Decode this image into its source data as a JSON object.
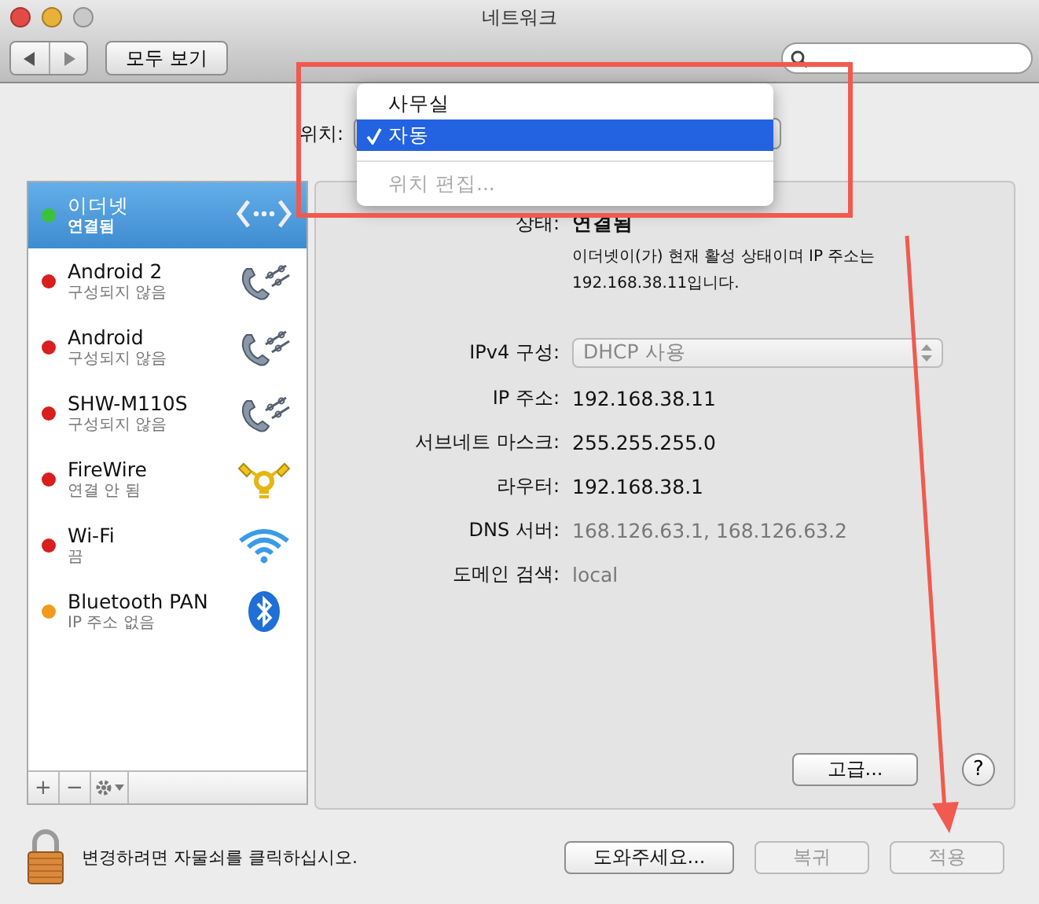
{
  "window": {
    "title": "네트워크"
  },
  "toolbar": {
    "show_all": "모두 보기"
  },
  "location": {
    "label": "위치:",
    "menu": [
      {
        "kind": "option",
        "label": "사무실",
        "selected": false,
        "disabled": false
      },
      {
        "kind": "option",
        "label": "자동",
        "selected": true,
        "disabled": false
      },
      {
        "kind": "separator"
      },
      {
        "kind": "option",
        "label": "위치 편집...",
        "selected": false,
        "disabled": true
      }
    ]
  },
  "services": [
    {
      "name": "이더넷",
      "status": "연결됨",
      "color": "#3cc23a",
      "kind": "ethernet",
      "selected": true
    },
    {
      "name": "Android 2",
      "status": "구성되지 않음",
      "color": "#d81e1e",
      "kind": "phone",
      "selected": false
    },
    {
      "name": "Android",
      "status": "구성되지 않음",
      "color": "#d81e1e",
      "kind": "phone",
      "selected": false
    },
    {
      "name": "SHW-M110S",
      "status": "구성되지 않음",
      "color": "#d81e1e",
      "kind": "phone",
      "selected": false
    },
    {
      "name": "FireWire",
      "status": "연결 안 됨",
      "color": "#d81e1e",
      "kind": "firewire",
      "selected": false
    },
    {
      "name": "Wi-Fi",
      "status": "끔",
      "color": "#d81e1e",
      "kind": "wifi",
      "selected": false
    },
    {
      "name": "Bluetooth PAN",
      "status": "IP 주소 없음",
      "color": "#f29a1c",
      "kind": "bluetooth",
      "selected": false
    }
  ],
  "list_buttons": [
    "+",
    "−"
  ],
  "details": {
    "status_label": "상태:",
    "status": "연결됨",
    "description": "이더넷이(가) 현재 활성 상태이며 IP 주소는\n192.168.38.11입니다.",
    "fields": [
      {
        "kind": "popup",
        "label": "IPv4 구성:",
        "value": "DHCP 사용",
        "dimmed": true
      },
      {
        "kind": "text",
        "label": "IP 주소:",
        "value": "192.168.38.11",
        "dimmed": false
      },
      {
        "kind": "text",
        "label": "서브네트 마스크:",
        "value": "255.255.255.0",
        "dimmed": false
      },
      {
        "kind": "text",
        "label": "라우터:",
        "value": "192.168.38.1",
        "dimmed": false
      },
      {
        "kind": "text",
        "label": "DNS 서버:",
        "value": "168.126.63.1, 168.126.63.2",
        "dimmed": true
      },
      {
        "kind": "text",
        "label": "도메인 검색:",
        "value": "local",
        "dimmed": true
      }
    ],
    "advanced": "고급...",
    "help": "?"
  },
  "lock_text": "변경하려면 자물쇠를 클릭하십시오.",
  "buttons": [
    {
      "label": "도와주세요...",
      "disabled": false
    },
    {
      "label": "복귀",
      "disabled": true
    },
    {
      "label": "적용",
      "disabled": true
    }
  ]
}
